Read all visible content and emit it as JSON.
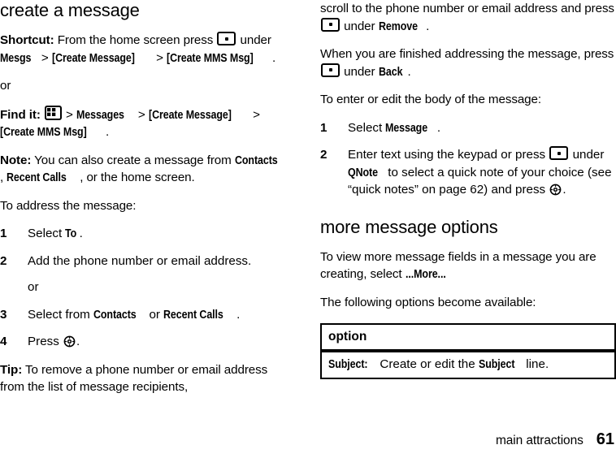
{
  "document": {
    "left_column": {
      "section_title": "create a message",
      "shortcut": {
        "lead": "Shortcut:",
        "text_1": " From the home screen press ",
        "icon_1": "softkey-icon",
        "text_2": " under ",
        "ui_1": "Mesgs",
        "sep_1": " > ",
        "ui_2": "[Create Message]",
        "sep_2": " > ",
        "ui_3": "[Create MMS Msg]",
        "text_3": "."
      },
      "or_1": "or",
      "find_it": {
        "lead": "Find it:",
        "text_1": " ",
        "icon_1": "menu-grid-icon",
        "sep_1": " > ",
        "ui_1": "Messages",
        "sep_2": " > ",
        "ui_2": "[Create Message]",
        "sep_3": " > ",
        "ui_3": "[Create MMS Msg]",
        "text_2": "."
      },
      "note": {
        "lead": "Note:",
        "text_1": " You can also create a message from ",
        "ui_1": "Contacts",
        "text_2": ", ",
        "ui_2": "Recent Calls",
        "text_3": ", or the home screen."
      },
      "address_intro": "To address the message:",
      "steps": [
        {
          "num": "1",
          "text_1": "Select ",
          "ui_1": "To",
          "text_2": "."
        },
        {
          "num": "2",
          "text_1": "Add the phone number or email address.",
          "sub": "or"
        },
        {
          "num": "3",
          "text_1": "Select from ",
          "ui_1": "Contacts",
          "text_2": " or ",
          "ui_2": "Recent Calls",
          "text_3": "."
        },
        {
          "num": "4",
          "text_1": "Press ",
          "icon_1": "center-select-icon",
          "text_2": "."
        }
      ],
      "tip": {
        "lead": "Tip:",
        "text_1": " To remove a phone number or email address from the list of message recipients,"
      }
    },
    "right_column": {
      "remove_para": {
        "text_1": "scroll to the phone number or email address and press ",
        "icon_1": "softkey-icon",
        "text_2": " under ",
        "ui_1": "Remove",
        "text_3": "."
      },
      "back_para": {
        "text_1": "When you are finished addressing the message, press ",
        "icon_1": "softkey-icon",
        "text_2": " under ",
        "ui_1": "Back",
        "text_3": "."
      },
      "body_intro": "To enter or edit the body of the message:",
      "steps": [
        {
          "num": "1",
          "text_1": "Select ",
          "ui_1": "Message",
          "text_2": "."
        },
        {
          "num": "2",
          "text_1": "Enter text using the keypad or press ",
          "icon_1": "softkey-icon",
          "text_2": " under ",
          "ui_1": "QNote",
          "text_3": " to select a quick note of your choice (see “quick notes” on page 62) and press ",
          "icon_2": "center-select-icon",
          "text_4": "."
        }
      ],
      "section_title": "more message options",
      "more_para": {
        "text_1": "To view more message fields in a message you are creating, select ",
        "ui_1": "...More...",
        "text_2": ""
      },
      "available_intro": "The following options become available:",
      "table": {
        "header": "option",
        "rows": [
          {
            "ui_1": "Subject:",
            "text_1": " Create or edit the ",
            "ui_2": "Subject",
            "text_2": " line."
          }
        ]
      }
    },
    "footer": {
      "chapter": "main attractions",
      "page_number": "61"
    }
  }
}
